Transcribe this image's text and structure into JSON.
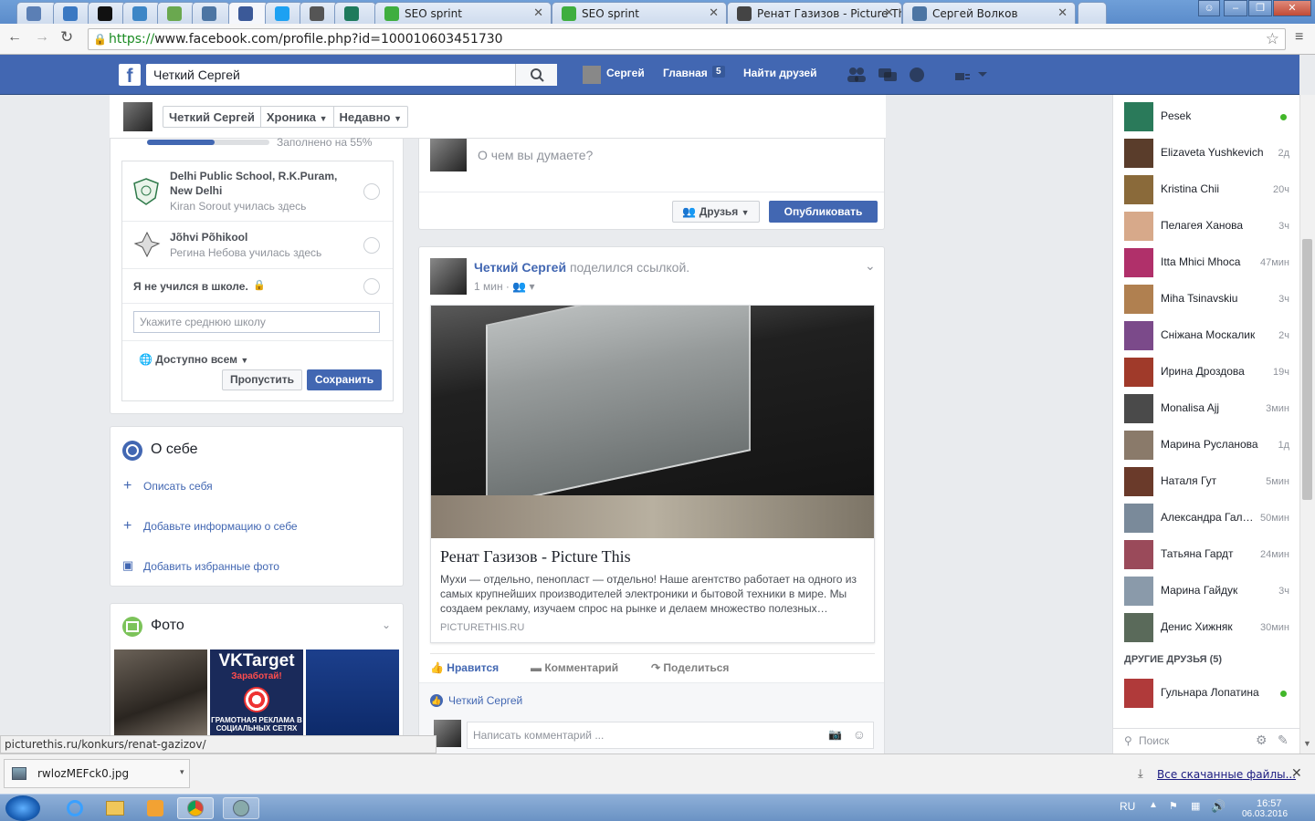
{
  "browser": {
    "tabs": [
      {
        "label": "",
        "icon": "mail-icon",
        "color": "#5b7fb5"
      },
      {
        "label": "",
        "icon": "globe-icon",
        "color": "#3a78c2"
      },
      {
        "label": "",
        "icon": "circle-logo-icon",
        "color": "#111111"
      },
      {
        "label": "",
        "icon": "target-icon",
        "color": "#3d86c6"
      },
      {
        "label": "",
        "icon": "puzzle-icon",
        "color": "#6aa84f"
      },
      {
        "label": "",
        "icon": "vk-icon",
        "color": "#4c75a3"
      },
      {
        "label": "",
        "icon": "facebook-icon",
        "color": "#3b5998"
      },
      {
        "label": "",
        "icon": "twitter-icon",
        "color": "#1da1f2"
      },
      {
        "label": "",
        "icon": "instagram-icon",
        "color": "#555555"
      },
      {
        "label": "",
        "icon": "check-icon",
        "color": "#1e7a5c"
      },
      {
        "label": "SEO sprint",
        "icon": "seo-sprint-icon",
        "color": "#3fae3f"
      },
      {
        "label": "SEO sprint",
        "icon": "seo-sprint-icon",
        "color": "#3fae3f"
      },
      {
        "label": "Ренат Газизов - Picture Th",
        "icon": "picture-this-icon",
        "color": "#444444"
      },
      {
        "label": "Сергей Волков",
        "icon": "vk-icon",
        "color": "#4c75a3"
      }
    ],
    "url_https": "https://",
    "url_rest": "www.facebook.com/profile.php?id=100010603451730",
    "status_url": "picturethis.ru/konkurs/renat-gazizov/"
  },
  "fb_header": {
    "search_value": "Четкий Сергей",
    "user_name": "Сергей",
    "home_label": "Главная",
    "home_count": "5",
    "find_friends": "Найти друзей"
  },
  "profile_bar": {
    "name": "Четкий Сергей",
    "timeline": "Хроника",
    "recent": "Недавно"
  },
  "education": {
    "progress_text": "Заполнено на 55%",
    "progress": 0.55,
    "schools": [
      {
        "name": "Delhi Public School, R.K.Puram, New Delhi",
        "sub": "Kiran Sorout училась здесь"
      },
      {
        "name": "Jõhvi Põhikool",
        "sub": "Регина Небова училась здесь"
      }
    ],
    "no_school": "Я не учился в школе.",
    "input_placeholder": "Укажите среднюю школу",
    "privacy": "Доступно всем",
    "skip": "Пропустить",
    "save": "Сохранить"
  },
  "about": {
    "title": "О себе",
    "items": [
      "Описать себя",
      "Добавьте информацию о себе",
      "Добавить избранные фото"
    ]
  },
  "photos": {
    "title": "Фото",
    "vk_title": "VKTarget",
    "vk_sub": "Заработай!",
    "vk_bottom": "ГРАМОТНАЯ РЕКЛАМА В СОЦИАЛЬНЫХ СЕТЯХ"
  },
  "composer": {
    "placeholder": "О чем вы думаете?",
    "audience": "Друзья",
    "publish": "Опубликовать"
  },
  "post": {
    "author": "Четкий Сергей",
    "action": "поделился ссылкой.",
    "time": "1 мин",
    "link_title": "Ренат Газизов - Picture This",
    "link_desc": "Мухи — отдельно, пенопласт — отдельно! Наше агентство работает на одного из самых крупнейших производителей электроники и бытовой техники в мире. Мы создаем рекламу, изучаем спрос на рынке и делаем множество полезных…",
    "link_domain": "PICTURETHIS.RU",
    "like": "Нравится",
    "comment": "Комментарий",
    "share": "Поделиться",
    "liker": "Четкий Сергей",
    "comment_placeholder": "Написать комментарий ..."
  },
  "chat": {
    "contacts": [
      {
        "name": "Pesek",
        "time": "",
        "online": true,
        "color": "#2a7a5a"
      },
      {
        "name": "Elizaveta Yushkevich",
        "time": "2д",
        "online": false,
        "color": "#5a3d2b"
      },
      {
        "name": "Kristina Chii",
        "time": "20ч",
        "online": false,
        "color": "#8a6a3a"
      },
      {
        "name": "Пелагея Ханова",
        "time": "3ч",
        "online": false,
        "color": "#d7a98a"
      },
      {
        "name": "Itta Mhici Mhoca",
        "time": "47мин",
        "online": false,
        "color": "#b0306a"
      },
      {
        "name": "Miha Tsinavskiu",
        "time": "3ч",
        "online": false,
        "color": "#b08050"
      },
      {
        "name": "Сніжана Москалик",
        "time": "2ч",
        "online": false,
        "color": "#7b4a8a"
      },
      {
        "name": "Ирина Дроздова",
        "time": "19ч",
        "online": false,
        "color": "#a03a2a"
      },
      {
        "name": "Monalisa Ajj",
        "time": "3мин",
        "online": false,
        "color": "#4a4a4a"
      },
      {
        "name": "Марина Русланова",
        "time": "1д",
        "online": false,
        "color": "#8a7a6a"
      },
      {
        "name": "Наталя Гут",
        "time": "5мин",
        "online": false,
        "color": "#6a3a2a"
      },
      {
        "name": "Александра Гал…",
        "time": "50мин",
        "online": false,
        "color": "#7a8a9a"
      },
      {
        "name": "Татьяна Гардт",
        "time": "24мин",
        "online": false,
        "color": "#9a4a5a"
      },
      {
        "name": "Марина Гайдук",
        "time": "3ч",
        "online": false,
        "color": "#8a9aaa"
      },
      {
        "name": "Денис Хижняк",
        "time": "30мин",
        "online": false,
        "color": "#5a6a5a"
      }
    ],
    "other_friends": "ДРУГИЕ ДРУЗЬЯ (5)",
    "other": [
      {
        "name": "Гульнара Лопатина",
        "time": "",
        "online": true,
        "color": "#b03a3a"
      }
    ],
    "search_placeholder": "Поиск"
  },
  "downloads": {
    "file": "rwlozMEFck0.jpg",
    "all": "Все скачанные файлы..."
  },
  "taskbar": {
    "lang": "RU",
    "time": "16:57",
    "date": "06.03.2016"
  }
}
